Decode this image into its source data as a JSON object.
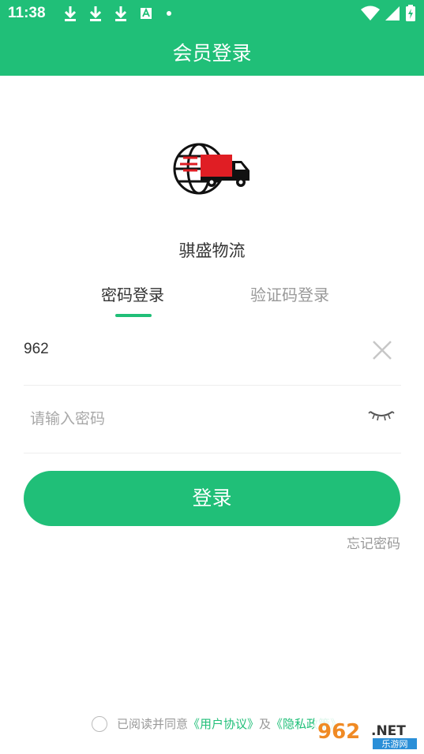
{
  "status_bar": {
    "time": "11:38",
    "icons": [
      "download-icon",
      "download-icon",
      "download-icon",
      "font-icon",
      "dot-icon"
    ],
    "right_icons": [
      "wifi-icon",
      "signal-icon",
      "battery-icon"
    ]
  },
  "appbar": {
    "title": "会员登录"
  },
  "brand": {
    "name": "骐盛物流",
    "logo": "globe-truck-icon",
    "accent": "#20bf78"
  },
  "tabs": [
    {
      "label": "密码登录",
      "active": true
    },
    {
      "label": "验证码登录",
      "active": false
    }
  ],
  "form": {
    "account_value": "962",
    "password_placeholder": "请输入密码",
    "login_label": "登录",
    "forgot_label": "忘记密码"
  },
  "agreement": {
    "prefix": "已阅读并同意",
    "user_agreement": "《用户协议》",
    "and": "及",
    "privacy_policy": "《隐私政策》"
  },
  "watermark": {
    "brand": "962",
    "suffix": ".NET",
    "sub": "乐游网"
  }
}
